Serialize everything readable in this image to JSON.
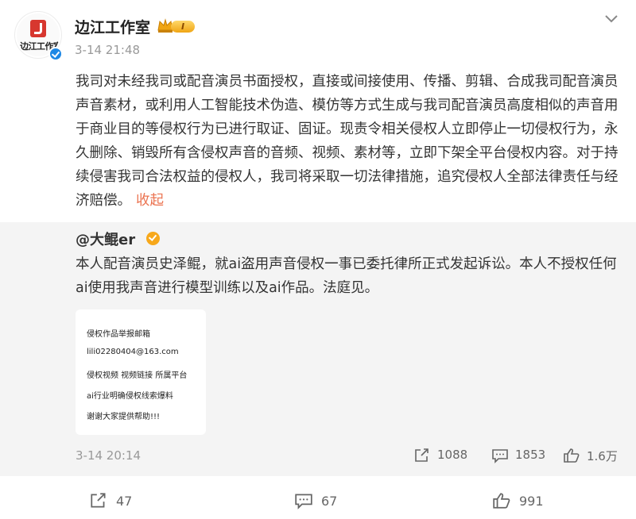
{
  "header": {
    "avatar_text": "边江工作室",
    "username": "边江工作室",
    "vip_level": "I",
    "time": "3-14 21:48"
  },
  "post": {
    "text": "我司对未经我司或配音演员书面授权，直接或间接使用、传播、剪辑、合成我司配音演员声音素材，或利用人工智能技术伪造、模仿等方式生成与我司配音演员高度相似的声音用于商业目的等侵权行为已进行取证、固证。现责令相关侵权人立即停止一切侵权行为，永久删除、销毁所有含侵权声音的音频、视频、素材等，立即下架全平台侵权内容。对于持续侵害我司合法权益的侵权人，我司将采取一切法律措施，追究侵权人全部法律责任与经济赔偿。",
    "collapse_label": "收起"
  },
  "repost": {
    "author": "@大鲲er",
    "text": "本人配音演员史泽鲲，就ai盗用声音侵权一事已委托律所正式发起诉讼。本人不授权任何ai使用我声音进行模型训练以及ai作品。法庭见。",
    "image_lines": [
      "侵权作品举报邮箱",
      "lili02280404@163.com",
      "侵权视频 视频链接 所属平台",
      "ai行业明确侵权线索爆料",
      "谢谢大家提供帮助!!!"
    ],
    "time": "3-14 20:14",
    "shares": "1088",
    "comments": "1853",
    "likes": "1.6万"
  },
  "actions": {
    "shares": "47",
    "comments": "67",
    "likes": "991"
  },
  "colors": {
    "accent_link": "#eb7350",
    "verified_blue": "#1e88e5",
    "verified_gold": "#f7a81b",
    "brand_red": "#d7372f"
  }
}
